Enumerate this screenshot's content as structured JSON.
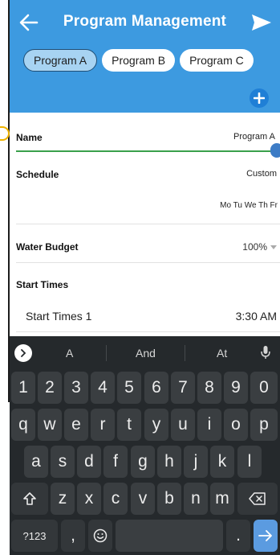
{
  "header": {
    "title": "Program Management",
    "back_icon": "arrow-left-icon",
    "send_icon": "send-icon",
    "background": "#3d9ae0"
  },
  "tabs": [
    {
      "label": "Program A",
      "active": true
    },
    {
      "label": "Program B",
      "active": false
    },
    {
      "label": "Program C",
      "active": false
    }
  ],
  "add_button_icon": "plus-circle-icon",
  "form": {
    "name": {
      "label": "Name",
      "value": "Program A"
    },
    "schedule": {
      "label": "Schedule",
      "value": "Custom",
      "days": "Mo Tu We Th Fr"
    },
    "water_budget": {
      "label": "Water Budget",
      "value": "100%"
    },
    "start_times": {
      "label": "Start Times",
      "item_label": "Start Times 1",
      "item_value": "3:30 AM"
    }
  },
  "keyboard": {
    "suggestions": [
      "A",
      "And",
      "At"
    ],
    "row1": [
      "1",
      "2",
      "3",
      "4",
      "5",
      "6",
      "7",
      "8",
      "9",
      "0"
    ],
    "row2": [
      "q",
      "w",
      "e",
      "r",
      "t",
      "y",
      "u",
      "i",
      "o",
      "p"
    ],
    "row3": [
      "a",
      "s",
      "d",
      "f",
      "g",
      "h",
      "j",
      "k",
      "l"
    ],
    "row4": [
      "z",
      "x",
      "c",
      "v",
      "b",
      "n",
      "m"
    ],
    "symbols_label": "?123",
    "comma": ",",
    "period": ".",
    "accent_color": "#5b9be0"
  }
}
